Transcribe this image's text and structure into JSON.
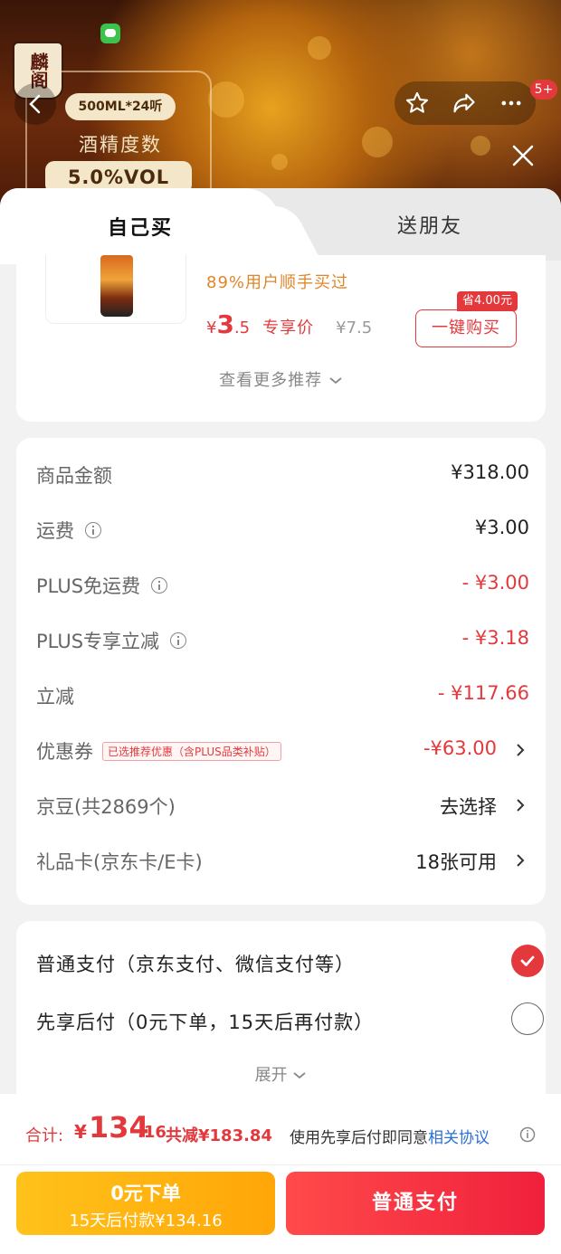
{
  "banner": {
    "brand_logo_text": "麟阁",
    "spec_pill": "500ML*24听",
    "spec_label": "酒精度数",
    "spec_value": "5.0%VOL",
    "cart_badge": "5+"
  },
  "tabs": {
    "self": "自己买",
    "gift": "送朋友"
  },
  "recommendation": {
    "users_text": "89%用户顺手买过",
    "currency": "¥",
    "price_int": "3",
    "price_dec": ".5",
    "price_tag": "专享价",
    "original_price": "¥7.5",
    "save_tag": "省4.00元",
    "buy_button": "一键购买",
    "more_link": "查看更多推荐"
  },
  "price_detail": {
    "rows": [
      {
        "label": "商品金额",
        "value": "¥318.00"
      },
      {
        "label": "运费",
        "value": "¥3.00"
      },
      {
        "label": "PLUS免运费",
        "value": "- ¥3.00"
      },
      {
        "label": "PLUS专享立减",
        "value": "- ¥3.18"
      },
      {
        "label": "立减",
        "value": "- ¥117.66"
      },
      {
        "label": "优惠券",
        "tag": "已选推荐优惠（含PLUS品类补贴）",
        "value": "-¥63.00"
      },
      {
        "label": "京豆(共2869个)",
        "value": "去选择"
      },
      {
        "label": "礼品卡(京东卡/E卡)",
        "value": "18张可用"
      }
    ]
  },
  "payment": {
    "options": [
      {
        "label": "普通支付（京东支付、微信支付等）",
        "selected": true
      },
      {
        "label": "先享后付（0元下单，15天后再付款）",
        "selected": false
      }
    ],
    "expand": "展开"
  },
  "footer": {
    "total_label": "合计:",
    "total_currency": "¥",
    "total_int": "134",
    "total_dec": ".16",
    "total_save": "共减¥183.84",
    "agree_text": "使用先享后付即同意",
    "agree_link": "相关协议",
    "later_button_title": "0元下单",
    "later_button_sub": "15天后付款¥134.16",
    "pay_button": "普通支付"
  },
  "colors": {
    "accent": "#e4393c",
    "link": "#2a6fd6",
    "later_button": "#ffb010",
    "orange_text": "#e0862a"
  }
}
